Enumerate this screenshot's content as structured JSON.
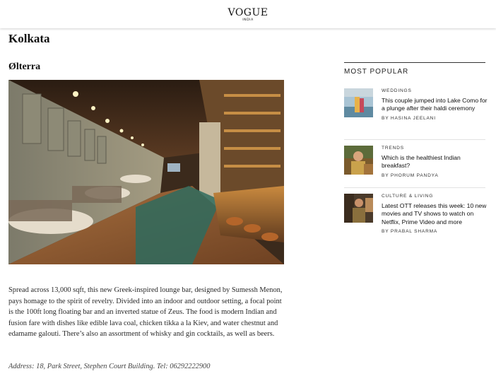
{
  "header": {
    "logo": "VOGUE",
    "logo_sub": "INDIA"
  },
  "article": {
    "city": "Kolkata",
    "venue": "Ølterra",
    "body": "Spread across 13,000 sqft, this new Greek-inspired lounge bar, designed by Sumessh Menon, pays homage to the spirit of revelry. Divided into an indoor and outdoor setting, a focal point is the 100ft long floating bar and an inverted statue of Zeus. The food is modern Indian and fusion fare with dishes like edible lava coal, chicken tikka a la Kiev, and water chestnut and edamame galouti. There’s also an assortment of whisky and gin cocktails, as well as beers.",
    "address": "Address: 18, Park Street, Stephen Court Building. Tel: 06292222900"
  },
  "most_popular": {
    "title": "MOST POPULAR",
    "stories": [
      {
        "category": "WEDDINGS",
        "headline": "This couple jumped into Lake Como for a plunge after their haldi ceremony",
        "byline": "BY HASINA JEELANI"
      },
      {
        "category": "TRENDS",
        "headline": "Which is the healthiest Indian breakfast?",
        "byline": "BY PHORUM PANDYA"
      },
      {
        "category": "CULTURE & LIVING",
        "headline": "Latest OTT releases this week: 10 new movies and TV shows to watch on Netflix, Prime Video and more",
        "byline": "BY PRABAL SHARMA"
      }
    ]
  },
  "colors": {
    "accent": "#1a1a1a",
    "wood": "#8a5a33",
    "teal_floor": "#2f6b5e"
  }
}
